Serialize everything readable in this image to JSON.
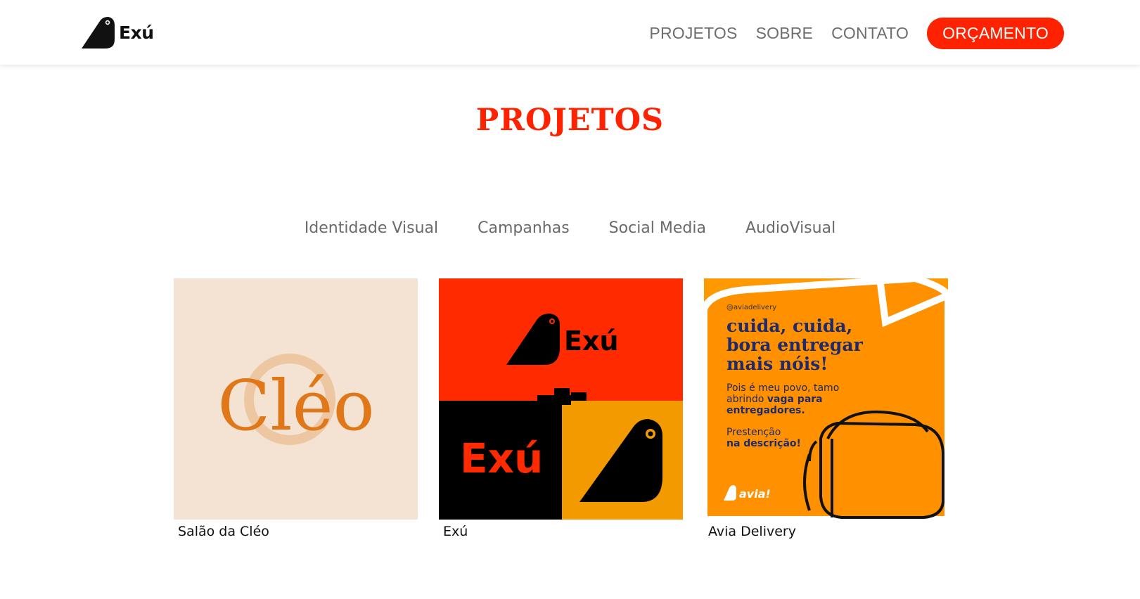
{
  "brand": {
    "name": "Exú",
    "accent": "#ff2200"
  },
  "nav": {
    "items": [
      {
        "label": "PROJETOS"
      },
      {
        "label": "SOBRE"
      },
      {
        "label": "CONTATO"
      }
    ],
    "cta": "ORÇAMENTO"
  },
  "page": {
    "title": "PROJETOS"
  },
  "filters": [
    {
      "label": "Identidade Visual"
    },
    {
      "label": "Campanhas"
    },
    {
      "label": "Social Media"
    },
    {
      "label": "AudioVisual"
    }
  ],
  "projects": [
    {
      "caption": "Salão da Cléo",
      "art": {
        "wordmark": "Cléo",
        "bg": "#f4e3d2",
        "color": "#e07718"
      }
    },
    {
      "caption": "Exú",
      "art": {
        "wordmark": "Exú",
        "colors": [
          "#ff2a00",
          "#000000",
          "#f39a00"
        ]
      }
    },
    {
      "caption": "Avia Delivery",
      "art": {
        "handle": "@aviadelivery",
        "headline": [
          "cuida, cuida,",
          "bora entregar",
          "mais nóis!"
        ],
        "body_lines": [
          "Pois é meu povo, tamo",
          "abrindo ",
          "vaga para",
          "entregadores."
        ],
        "cta_lines": [
          "Prestenção",
          "na descrição!"
        ],
        "brand": "avia!",
        "bg": "#ff9900"
      }
    }
  ]
}
